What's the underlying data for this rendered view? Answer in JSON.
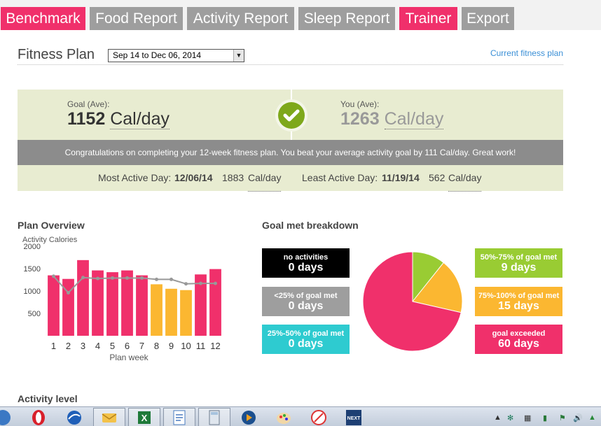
{
  "tabs": [
    {
      "label": "Benchmark",
      "color": "#f0306b"
    },
    {
      "label": "Food Report",
      "color": "#9e9e9e"
    },
    {
      "label": "Activity Report",
      "color": "#9e9e9e"
    },
    {
      "label": "Sleep Report",
      "color": "#9e9e9e"
    },
    {
      "label": "Trainer",
      "color": "#f0306b"
    },
    {
      "label": "Export",
      "color": "#9e9e9e"
    }
  ],
  "header": {
    "title": "Fitness Plan",
    "plan_select": "Sep 14 to Dec 06, 2014",
    "current_plan_link": "Current fitness plan"
  },
  "summary": {
    "goal_label": "Goal (Ave):",
    "goal_value": "1152",
    "goal_unit": "Cal/day",
    "you_label": "You (Ave):",
    "you_value": "1263",
    "you_unit": "Cal/day",
    "message": "Congratulations on completing your 12-week fitness plan. You beat your average activity goal by 111 Cal/day. Great work!",
    "most_active_label": "Most Active Day:",
    "most_active_date": "12/06/14",
    "most_active_value": "1883",
    "least_active_label": "Least Active Day:",
    "least_active_date": "11/19/14",
    "least_active_value": "562",
    "day_unit": "Cal/day"
  },
  "plan_overview": {
    "title": "Plan Overview",
    "ylabel": "Activity Calories",
    "xlabel": "Plan week"
  },
  "chart_data": {
    "type": "bar",
    "ylabel": "Activity Calories",
    "xlabel": "Plan week",
    "ylim": [
      0,
      2000
    ],
    "yticks": [
      2000,
      1500,
      1000,
      500
    ],
    "categories": [
      "1",
      "2",
      "3",
      "4",
      "5",
      "6",
      "7",
      "8",
      "9",
      "10",
      "11",
      "12"
    ],
    "series": [
      {
        "values": [
          1350,
          1270,
          1690,
          1460,
          1420,
          1460,
          1350,
          1150,
          1050,
          1020,
          1370,
          1490
        ]
      },
      {
        "values": [
          1330,
          960,
          1300,
          1280,
          1290,
          1290,
          1290,
          1260,
          1260,
          1160,
          1170,
          1170
        ]
      }
    ],
    "bar_colors": [
      "#f0306b",
      "#f0306b",
      "#f0306b",
      "#f0306b",
      "#f0306b",
      "#f0306b",
      "#f0306b",
      "#fbb731",
      "#fbb731",
      "#fbb731",
      "#f0306b",
      "#f0306b"
    ],
    "line_color": "#999999"
  },
  "breakdown": {
    "title": "Goal met breakdown",
    "left": [
      {
        "label": "no activities",
        "value": "0 days",
        "color": "#000000"
      },
      {
        "label": "<25% of goal met",
        "value": "0 days",
        "color": "#9e9e9e"
      },
      {
        "label": "25%-50% of goal met",
        "value": "0 days",
        "color": "#2ecbd0"
      }
    ],
    "right": [
      {
        "label": "50%-75% of goal met",
        "value": "9 days",
        "color": "#99cc33"
      },
      {
        "label": "75%-100% of goal met",
        "value": "15 days",
        "color": "#fbb731"
      },
      {
        "label": "goal exceeded",
        "value": "60 days",
        "color": "#f0306b"
      }
    ]
  },
  "pie_data": {
    "type": "pie",
    "slices": [
      {
        "label": "50%-75% of goal met",
        "value": 9,
        "color": "#99cc33"
      },
      {
        "label": "75%-100% of goal met",
        "value": 15,
        "color": "#fbb731"
      },
      {
        "label": "goal exceeded",
        "value": 60,
        "color": "#f0306b"
      }
    ]
  },
  "activity_level": {
    "title": "Activity level"
  }
}
